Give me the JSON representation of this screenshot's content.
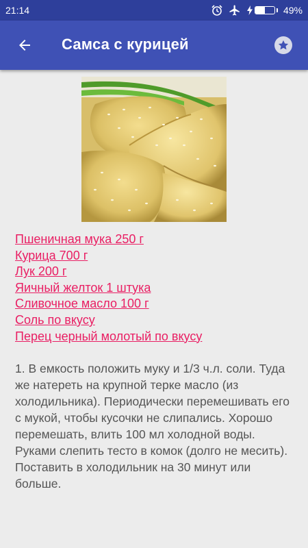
{
  "status_bar": {
    "time": "21:14",
    "battery_percent": "49%",
    "battery_level": 0.49,
    "icons": [
      "alarm-icon",
      "airplane-icon",
      "charging-icon",
      "battery-icon"
    ]
  },
  "app_bar": {
    "title": "Самса с курицей",
    "back_icon": "arrow-back-icon",
    "favorite_icon": "star-icon"
  },
  "ingredients": [
    "Пшеничная мука 250 г",
    "Курица 700 г",
    "Лук 200 г",
    "Яичный желток 1 штука",
    "Сливочное масло 100 г",
    "Соль по вкусу",
    "Перец черный молотый по вкусу"
  ],
  "steps": [
    "1. В емкость положить муку и 1/3 ч.л. соли. Туда же натереть на крупной терке масло (из холодильника). Периодически перемешивать его с мукой, чтобы кусочки не слипались. Хорошо перемешать, влить 100 мл холодной воды. Руками слепить тесто в комок (долго не месить). Поставить в холодильник на 30 минут или больше."
  ],
  "colors": {
    "status_bar": "#2e3f9b",
    "app_bar": "#3f51b5",
    "link": "#e91e63",
    "background": "#ececec",
    "body_text": "#555555"
  }
}
